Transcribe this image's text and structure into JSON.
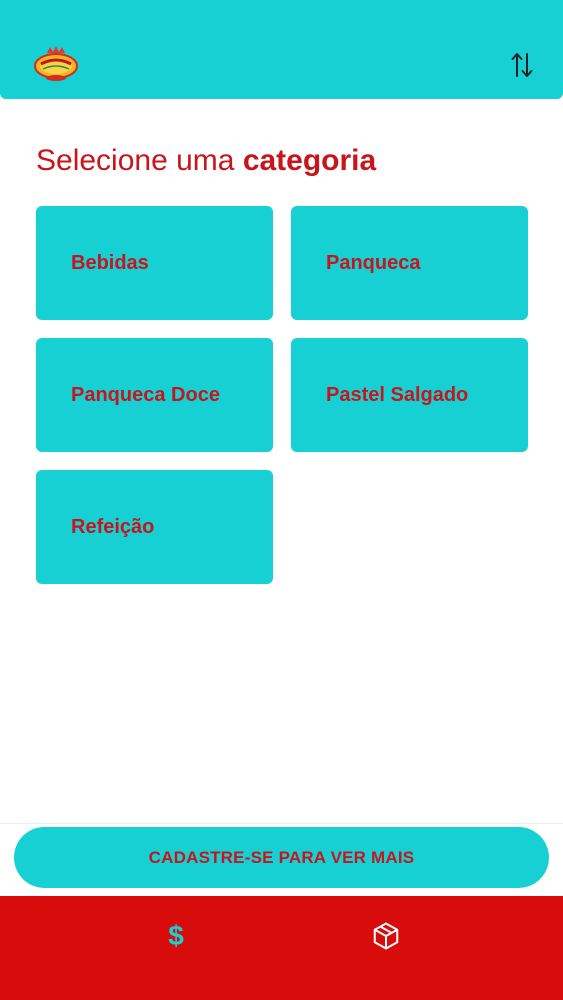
{
  "app": {
    "brand_colors": {
      "primary": "#16d0d4",
      "accent": "#c8151b",
      "nav_background": "#d90c0c"
    }
  },
  "header": {
    "logo_icon": "restaurant-logo",
    "sort_icon": "sort-arrows-icon"
  },
  "main": {
    "title_regular": "Selecione uma",
    "title_bold": "categoria",
    "categories": [
      {
        "label": "Bebidas"
      },
      {
        "label": "Panqueca"
      },
      {
        "label": "Panqueca Doce"
      },
      {
        "label": "Pastel Salgado"
      },
      {
        "label": "Refeição"
      }
    ]
  },
  "cta": {
    "label": "CADASTRE-SE PARA VER MAIS"
  },
  "bottom_nav": {
    "items": [
      {
        "icon": "dollar-icon",
        "glyph": "$"
      },
      {
        "icon": "package-icon"
      }
    ]
  }
}
